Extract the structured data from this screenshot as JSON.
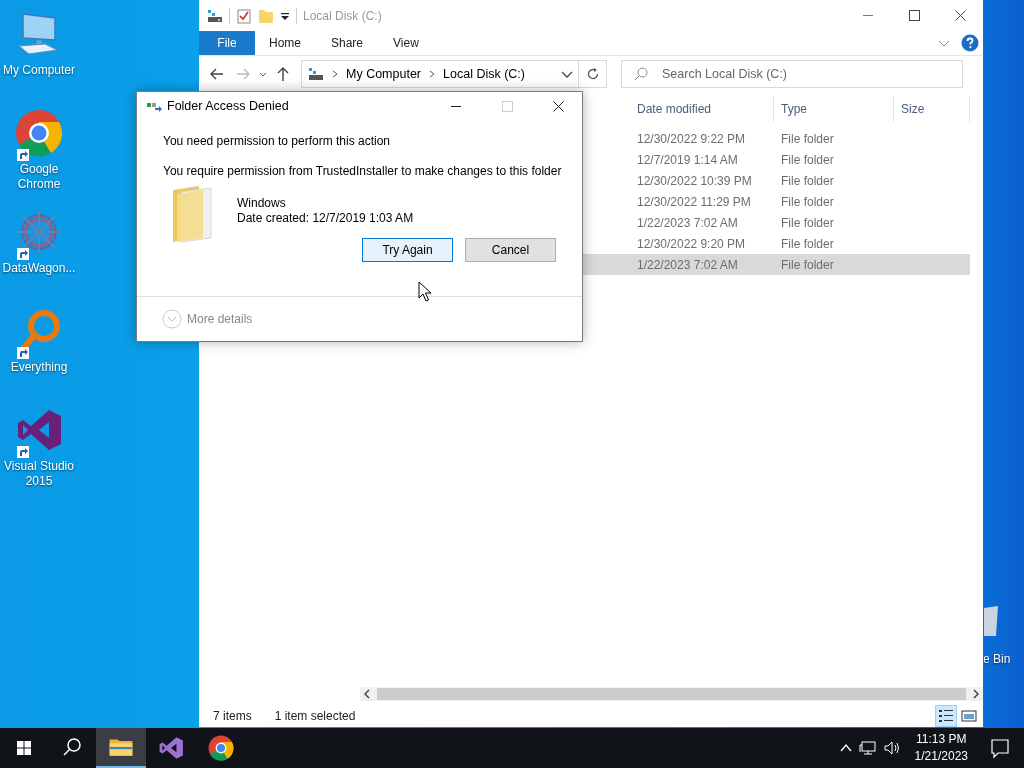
{
  "desktop": {
    "icons": [
      {
        "kind": "computer",
        "label": "My Computer",
        "shortcut": false
      },
      {
        "kind": "chrome",
        "label": "Google Chrome",
        "shortcut": true
      },
      {
        "kind": "datawagon",
        "label": "DataWagon...",
        "shortcut": true
      },
      {
        "kind": "everything",
        "label": "Everything",
        "shortcut": true
      },
      {
        "kind": "vs",
        "label": "Visual Studio 2015",
        "shortcut": true
      }
    ],
    "recycle_bin": {
      "label": "e Bin"
    }
  },
  "explorer": {
    "title": "Local Disk (C:)",
    "file_tab": "File",
    "ribbon_tabs": [
      "Home",
      "Share",
      "View"
    ],
    "breadcrumb": [
      "My Computer",
      "Local Disk (C:)"
    ],
    "search": {
      "placeholder": "Search Local Disk (C:)"
    },
    "columns": [
      "Date modified",
      "Type",
      "Size"
    ],
    "rows": [
      {
        "date": "12/30/2022 9:22 PM",
        "type": "File folder",
        "selected": false
      },
      {
        "date": "12/7/2019 1:14 AM",
        "type": "File folder",
        "selected": false
      },
      {
        "date": "12/30/2022 10:39 PM",
        "type": "File folder",
        "selected": false
      },
      {
        "date": "12/30/2022 11:29 PM",
        "type": "File folder",
        "selected": false
      },
      {
        "date": "1/22/2023 7:02 AM",
        "type": "File folder",
        "selected": false
      },
      {
        "date": "12/30/2022 9:20 PM",
        "type": "File folder",
        "selected": false
      },
      {
        "date": "1/22/2023 7:02 AM",
        "type": "File folder",
        "selected": true
      }
    ],
    "status": {
      "item_count": "7 items",
      "selection": "1 item selected"
    },
    "view_buttons": [
      {
        "kind": "details",
        "selected": true
      },
      {
        "kind": "large-icons",
        "selected": false
      }
    ]
  },
  "dialog": {
    "title": "Folder Access Denied",
    "maximize_enabled": false,
    "heading": "You need permission to perform this action",
    "message": "You require permission from TrustedInstaller to make changes to this folder",
    "item": {
      "name": "Windows",
      "detail": "Date created: 12/7/2019 1:03 AM"
    },
    "buttons": [
      {
        "label": "Try Again",
        "default": true
      },
      {
        "label": "Cancel",
        "default": false
      }
    ],
    "more_details": "More details"
  },
  "taskbar": {
    "apps": [
      {
        "kind": "explorer",
        "active": true
      },
      {
        "kind": "vs",
        "active": false
      },
      {
        "kind": "chrome",
        "active": false
      }
    ],
    "time": "11:13 PM",
    "date": "1/21/2023"
  }
}
